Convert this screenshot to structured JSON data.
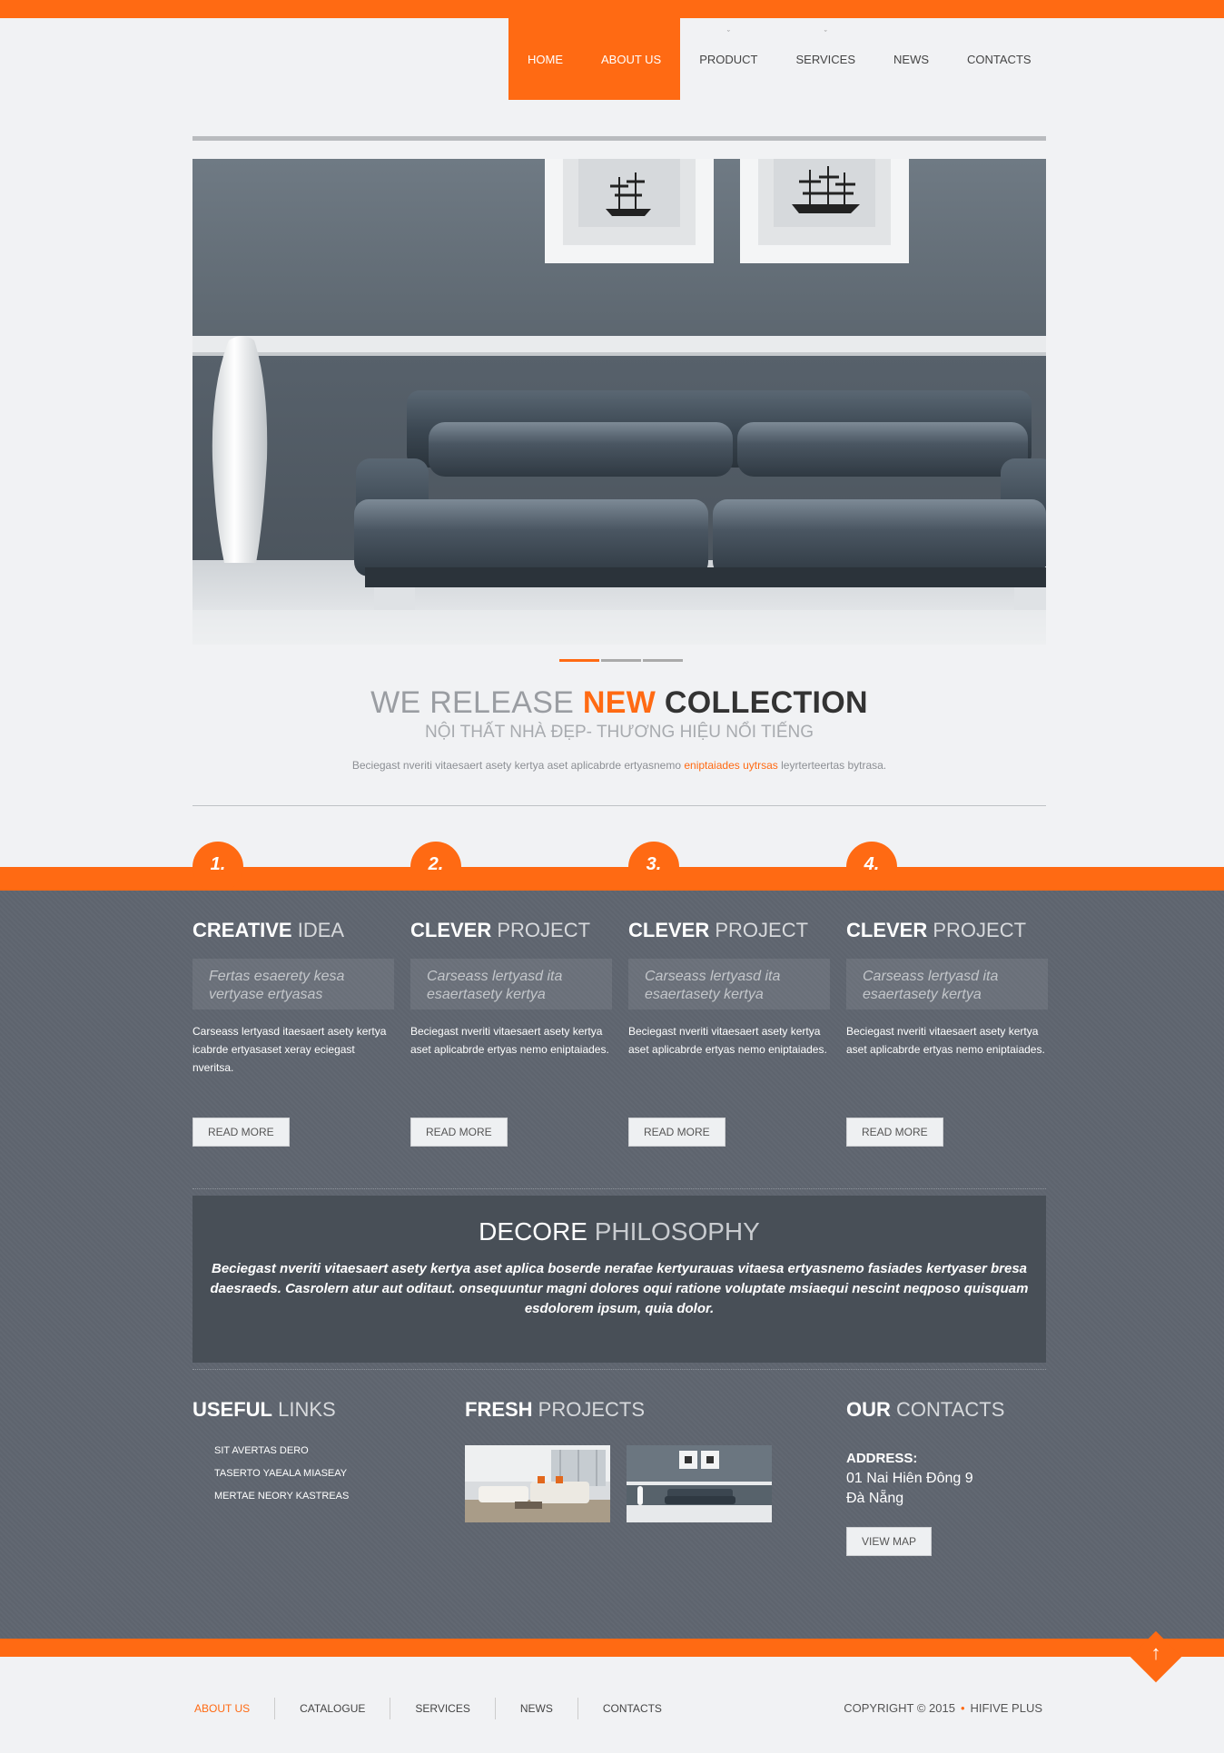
{
  "nav": {
    "items": [
      {
        "label": "HOME",
        "has_dropdown": false
      },
      {
        "label": "ABOUT US",
        "has_dropdown": false
      },
      {
        "label": "PRODUCT",
        "has_dropdown": true
      },
      {
        "label": "SERVICES",
        "has_dropdown": true
      },
      {
        "label": "NEWS",
        "has_dropdown": false
      },
      {
        "label": "CONTACTS",
        "has_dropdown": false
      }
    ],
    "active_index": [
      0,
      1
    ]
  },
  "hero": {
    "slide_count": 3,
    "active_slide": 1
  },
  "intro": {
    "title_part1": "WE RELEASE ",
    "title_part2": "NEW",
    "title_part3": " COLLECTION",
    "subtitle": "NỘI THẤT NHÀ ĐẸP- THƯƠNG HIỆU NỔI TIẾNG",
    "text_before": "Beciegast nveriti vitaesaert asety kertya aset aplicabrde ertyasnemo ",
    "text_highlight": "eniptaiades uytrsas",
    "text_after": " leyrterteertas bytrasa."
  },
  "features": [
    {
      "num": "1.",
      "title_bold": "CREATIVE",
      "title_light": " IDEA",
      "quote": "Fertas esaerety kesa vertyase ertyasas",
      "body": "Carseass lertyasd itaesaert asety kertya icabrde ertyasaset xeray eciegast nveritsa.",
      "button": "READ MORE"
    },
    {
      "num": "2.",
      "title_bold": "CLEVER",
      "title_light": " PROJECT",
      "quote": "Carseass lertyasd ita esaertasety kertya",
      "body": "Beciegast nveriti vitaesaert asety kertya aset aplicabrde ertyas nemo eniptaiades.",
      "button": "READ MORE"
    },
    {
      "num": "3.",
      "title_bold": "CLEVER",
      "title_light": " PROJECT",
      "quote": "Carseass lertyasd ita esaertasety kertya",
      "body": "Beciegast nveriti vitaesaert asety kertya aset aplicabrde ertyas nemo eniptaiades.",
      "button": "READ MORE"
    },
    {
      "num": "4.",
      "title_bold": "CLEVER",
      "title_light": " PROJECT",
      "quote": "Carseass lertyasd ita esaertasety kertya",
      "body": "Beciegast nveriti vitaesaert asety kertya aset aplicabrde ertyas nemo eniptaiades.",
      "button": "READ MORE"
    }
  ],
  "philosophy": {
    "title_bold": "DECORE",
    "title_light": " PHILOSOPHY",
    "text": "Beciegast nveriti vitaesaert asety kertya aset aplica boserde nerafae kertyurauas vitaesa ertyasnemo fasiades kertyaser bresa daesraeds. Casrolern atur aut oditaut. onsequuntur magni dolores oqui ratione voluptate msiaequi nescint neqposo quisquam esdolorem ipsum, quia dolor."
  },
  "useful_links": {
    "title_bold": "USEFUL",
    "title_light": " LINKS",
    "items": [
      "SIT AVERTAS DERO",
      "TASERTO YAEALA MIASEAY",
      "MERTAE NEORY KASTREAS"
    ]
  },
  "fresh_projects": {
    "title_bold": "FRESH",
    "title_light": " PROJECTS"
  },
  "contacts": {
    "title_bold": "OUR",
    "title_light": " CONTACTS",
    "address_label": "ADDRESS:",
    "address_line1": "01 Nai Hiên Đông 9",
    "address_line2": "Đà Nẵng",
    "button": "VIEW MAP"
  },
  "footer": {
    "nav": [
      "ABOUT US",
      "CATALOGUE",
      "SERVICES",
      "NEWS",
      "CONTACTS"
    ],
    "copyright": "COPYRIGHT © 2015",
    "brand": "HIFIVE PLUS"
  },
  "colors": {
    "accent": "#ff6a13",
    "panel": "#5f6670",
    "page": "#f1f2f4"
  }
}
